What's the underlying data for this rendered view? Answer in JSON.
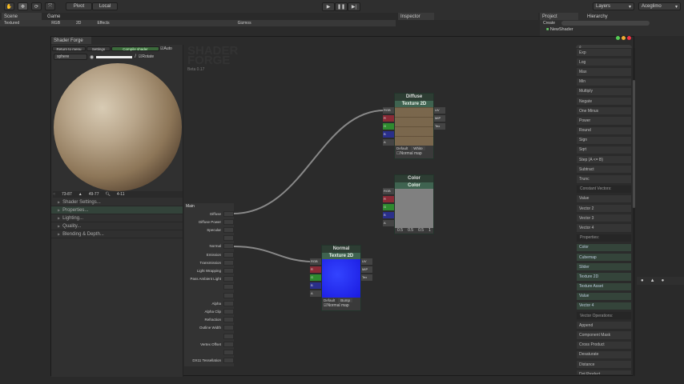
{
  "toolbar": {
    "pivot": "Pivot",
    "local": "Local",
    "layers": "Layers",
    "account": "Aceglimo"
  },
  "tabs": {
    "scene": "Scene",
    "game": "Game",
    "inspector": "Inspector",
    "project": "Project",
    "hierarchy": "Hierarchy"
  },
  "scene_bar": {
    "shading": "Textured",
    "rgb": "RGB",
    "mode_2d": "2D",
    "effects": "Effects",
    "gizmos": "Gizmos"
  },
  "project": {
    "create": "Create",
    "asset": "NewShader"
  },
  "shader_forge": {
    "title": "Shader Forge",
    "return": "Return to menu",
    "settings": "Settings",
    "compile": "Compile shader",
    "auto": "Auto",
    "mesh": "sphere",
    "rotate": "Rotate",
    "logo_top": "SHADER",
    "logo_bottom": "FORGE",
    "version": "Beta 0.17",
    "stats": {
      "verts": "73-87",
      "tris": "49-77",
      "passes": "4-11"
    },
    "sections": [
      "Shader Settings...",
      "Properties...",
      "Lighting...",
      "Quality...",
      "Blending & Depth..."
    ]
  },
  "main_node": {
    "title": "Main",
    "inputs": [
      "Diffuse",
      "Diffuse Power",
      "Specular",
      "",
      "Normal",
      "Emission",
      "Transmission",
      "Light Wrapping",
      "Pass Ambient Light",
      "",
      "",
      "Alpha",
      "Alpha Clip",
      "Refraction",
      "Outline Width",
      "",
      "Vertex Offset",
      "",
      "DX11 Tessellation"
    ]
  },
  "nodes": {
    "diffuse": {
      "title": "Diffuse",
      "type": "Texture 2D",
      "inputs": [
        "RGB",
        "R",
        "G",
        "B",
        "A"
      ],
      "outputs": [
        "UV",
        "MIP",
        "Tex"
      ],
      "default_label": "Default",
      "default_value": "White",
      "normal_map": "Normal map"
    },
    "color": {
      "title": "Color",
      "type": "Color",
      "inputs": [
        "RGB",
        "R",
        "G",
        "B",
        "A"
      ],
      "values": [
        "0.5",
        "0.5",
        "0.5",
        "1"
      ]
    },
    "normal": {
      "title": "Normal",
      "type": "Texture 2D",
      "inputs": [
        "RGB",
        "R",
        "G",
        "B",
        "A"
      ],
      "outputs": [
        "UV",
        "MIP",
        "Tex"
      ],
      "default_label": "Default",
      "default_value": "Bump",
      "normal_map": "Normal map"
    }
  },
  "library": [
    {
      "label": "Exp",
      "k": ""
    },
    {
      "label": "Log",
      "k": ""
    },
    {
      "label": "Max",
      "k": ""
    },
    {
      "label": "Min",
      "k": ""
    },
    {
      "label": "Multiply",
      "k": ""
    },
    {
      "label": "Negate",
      "k": ""
    },
    {
      "label": "One Minus",
      "k": ""
    },
    {
      "label": "Power",
      "k": ""
    },
    {
      "label": "Round",
      "k": ""
    },
    {
      "label": "Sign",
      "k": ""
    },
    {
      "label": "Sqrt",
      "k": ""
    },
    {
      "label": "Step (A <= B)",
      "k": ""
    },
    {
      "label": "Subtract",
      "k": ""
    },
    {
      "label": "Trunc",
      "k": ""
    },
    {
      "label": "Constant Vectors:",
      "k": "h"
    },
    {
      "label": "Value",
      "k": ""
    },
    {
      "label": "Vector 2",
      "k": ""
    },
    {
      "label": "Vector 3",
      "k": ""
    },
    {
      "label": "Vector 4",
      "k": ""
    },
    {
      "label": "Properties:",
      "k": "h"
    },
    {
      "label": "Color",
      "k": "p"
    },
    {
      "label": "Cubemap",
      "k": "p"
    },
    {
      "label": "Slider",
      "k": "p"
    },
    {
      "label": "Texture 2D",
      "k": "p"
    },
    {
      "label": "Texture Asset",
      "k": "p"
    },
    {
      "label": "Value",
      "k": "p"
    },
    {
      "label": "Vector 4",
      "k": "p"
    },
    {
      "label": "Vector Operations:",
      "k": "h"
    },
    {
      "label": "Append",
      "k": ""
    },
    {
      "label": "Component Mask",
      "k": ""
    },
    {
      "label": "Cross Product",
      "k": ""
    },
    {
      "label": "Desaturate",
      "k": ""
    },
    {
      "label": "Distance",
      "k": ""
    },
    {
      "label": "Dot Product",
      "k": ""
    }
  ]
}
